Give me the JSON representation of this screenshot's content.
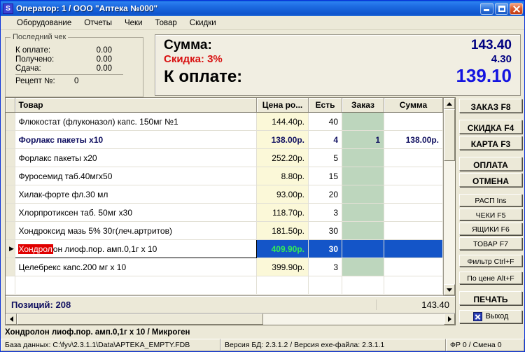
{
  "window": {
    "icon_label": "S",
    "title": "Оператор: 1 / ООО \"Аптека №000\"",
    "buttons": {
      "minimize": "minimize-button",
      "maximize": "maximize-button",
      "close": "close-button"
    }
  },
  "menu": {
    "items": [
      "Оборудование",
      "Отчеты",
      "Чеки",
      "Товар",
      "Скидки"
    ]
  },
  "last_check": {
    "legend": "Последний чек",
    "rows": [
      {
        "label": "К оплате:",
        "value": "0.00"
      },
      {
        "label": "Получено:",
        "value": "0.00"
      },
      {
        "label": "Сдача:",
        "value": "0.00"
      }
    ],
    "receipt_label": "Рецепт №:",
    "receipt_value": "0"
  },
  "totals": {
    "sum_label": "Сумма:",
    "sum_value": "143.40",
    "discount_label": "Скидка: 3%",
    "discount_value": "4.30",
    "pay_label": "К оплате:",
    "pay_value": "139.10",
    "discount_color": "#d81010",
    "pay_color": "#1414e0"
  },
  "grid": {
    "columns": [
      "Товар",
      "Цена ро...",
      "Есть",
      "Заказ",
      "Сумма"
    ],
    "rows": [
      {
        "marker": "",
        "name": "Флюкостат (флуконазол) капс. 150мг №1",
        "price": "144.40р.",
        "have": "40",
        "order": "",
        "sum": "",
        "bold": false,
        "selected": false
      },
      {
        "marker": "",
        "name": "Форлакс пакеты х10",
        "price": "138.00р.",
        "have": "4",
        "order": "1",
        "sum": "138.00р.",
        "bold": true,
        "selected": false
      },
      {
        "marker": "",
        "name": "Форлакс пакеты х20",
        "price": "252.20р.",
        "have": "5",
        "order": "",
        "sum": "",
        "bold": false,
        "selected": false
      },
      {
        "marker": "",
        "name": "Фуросемид таб.40мгх50",
        "price": "8.80р.",
        "have": "15",
        "order": "",
        "sum": "",
        "bold": false,
        "selected": false
      },
      {
        "marker": "",
        "name": "Хилак-форте фл.30 мл",
        "price": "93.00р.",
        "have": "20",
        "order": "",
        "sum": "",
        "bold": false,
        "selected": false
      },
      {
        "marker": "",
        "name": "Хлорпротиксен таб. 50мг х30",
        "price": "118.70р.",
        "have": "3",
        "order": "",
        "sum": "",
        "bold": false,
        "selected": false
      },
      {
        "marker": "",
        "name": "Хондроксид мазь 5% 30г(леч.артритов)",
        "price": "181.50р.",
        "have": "30",
        "order": "",
        "sum": "",
        "bold": false,
        "selected": false
      },
      {
        "marker": "▶",
        "name_highlight": "Хондрол",
        "name_rest": "он лиоф.пор. амп.0,1г х 10",
        "name": "Хондролон лиоф.пор. амп.0,1г х 10",
        "price": "409.90р.",
        "have": "30",
        "order": "",
        "sum": "",
        "bold": false,
        "selected": true
      },
      {
        "marker": "",
        "name": "Целебрекс капс.200 мг х 10",
        "price": "399.90р.",
        "have": "3",
        "order": "",
        "sum": "",
        "bold": false,
        "selected": false
      }
    ],
    "footer": {
      "positions_label": "Позиций: 208",
      "total": "143.40"
    }
  },
  "sidebar": {
    "buttons": [
      {
        "label": "ЗАКАЗ F8",
        "style": "big"
      },
      {
        "label": "СКИДКА F4",
        "style": "big"
      },
      {
        "label": "КАРТА F3",
        "style": "big"
      },
      {
        "label": "ОПЛАТА",
        "style": "big"
      },
      {
        "label": "ОТМЕНА",
        "style": "big"
      },
      {
        "label": "РАСП Ins",
        "style": "small"
      },
      {
        "label": "ЧЕКИ F5",
        "style": "small"
      },
      {
        "label": "ЯЩИКИ F6",
        "style": "small"
      },
      {
        "label": "ТОВАР F7",
        "style": "small"
      },
      {
        "label": "Фильтр Ctrl+F",
        "style": "small"
      },
      {
        "label": "По цене Alt+F",
        "style": "small"
      },
      {
        "label": "ПЕЧАТЬ",
        "style": "big"
      },
      {
        "label": "Выход",
        "style": "exit"
      }
    ]
  },
  "info_line": "Хондролон лиоф.пор. амп.0,1г х 10 / Микроген",
  "status_bar": {
    "database": "База данных: C:\\fyv\\2.3.1.1\\Data\\APTEKA_EMPTY.FDB",
    "versions": "Версия БД: 2.3.1.2 / Версия exe-файла: 2.3.1.1",
    "shift": "ФР 0 / Смена 0"
  }
}
